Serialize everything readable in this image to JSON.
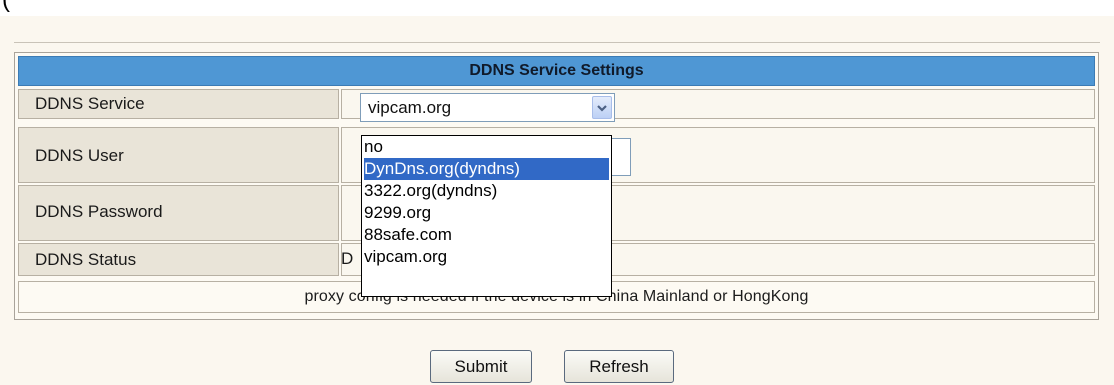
{
  "section_title": "DDNS Service Settings",
  "rows": [
    {
      "label": "DDNS Service"
    },
    {
      "label": "DDNS User"
    },
    {
      "label": "DDNS Password"
    },
    {
      "label": "DDNS Status",
      "value_fragment": "D"
    }
  ],
  "service_select": {
    "selected": "vipcam.org",
    "options": [
      "no",
      "DynDns.org(dyndns)",
      "3322.org(dyndns)",
      "9299.org",
      "88safe.com",
      "vipcam.org"
    ],
    "highlighted": "DynDns.org(dyndns)"
  },
  "note_text": "proxy config is needed if the device is in China Mainland or HongKong",
  "buttons": {
    "submit": "Submit",
    "refresh": "Refresh"
  },
  "icons": {
    "select_arrow": "chevron-down-icon"
  },
  "colors": {
    "header_bg": "#4f97d4",
    "highlight": "#3169c6",
    "label_bg": "#e9e4d8"
  }
}
